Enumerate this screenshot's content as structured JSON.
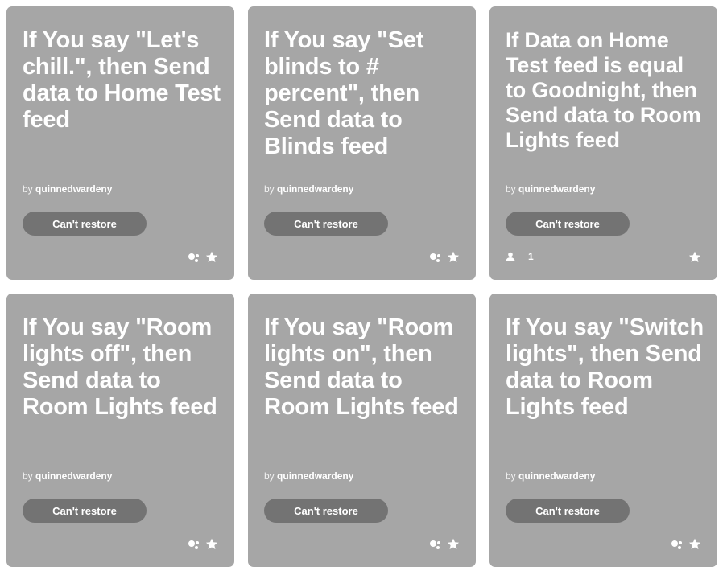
{
  "cards": [
    {
      "title": "If You say \"Let's chill.\", then Send data to Home Test feed",
      "by": "by",
      "author": "quinnedwardeny",
      "button": "Can't restore",
      "users_count": ""
    },
    {
      "title": "If You say \"Set blinds to # percent\", then Send data to Blinds feed",
      "by": "by",
      "author": "quinnedwardeny",
      "button": "Can't restore",
      "users_count": ""
    },
    {
      "title": "If Data on Home Test feed is equal to Goodnight, then Send data to Room Lights feed",
      "by": "by",
      "author": "quinnedwardeny",
      "button": "Can't restore",
      "users_count": "1"
    },
    {
      "title": "If You say \"Room lights off\", then Send data to Room Lights feed",
      "by": "by",
      "author": "quinnedwardeny",
      "button": "Can't restore",
      "users_count": ""
    },
    {
      "title": "If You say \"Room lights on\", then Send data to Room Lights feed",
      "by": "by",
      "author": "quinnedwardeny",
      "button": "Can't restore",
      "users_count": ""
    },
    {
      "title": "If You say \"Switch lights\", then Send data to Room Lights feed",
      "by": "by",
      "author": "quinnedwardeny",
      "button": "Can't restore",
      "users_count": ""
    }
  ],
  "colors": {
    "card_bg": "#a6a6a6",
    "button_bg": "#737373",
    "text": "#ffffff"
  },
  "icons": [
    "works-with-icon",
    "star-icon",
    "user-icon"
  ]
}
